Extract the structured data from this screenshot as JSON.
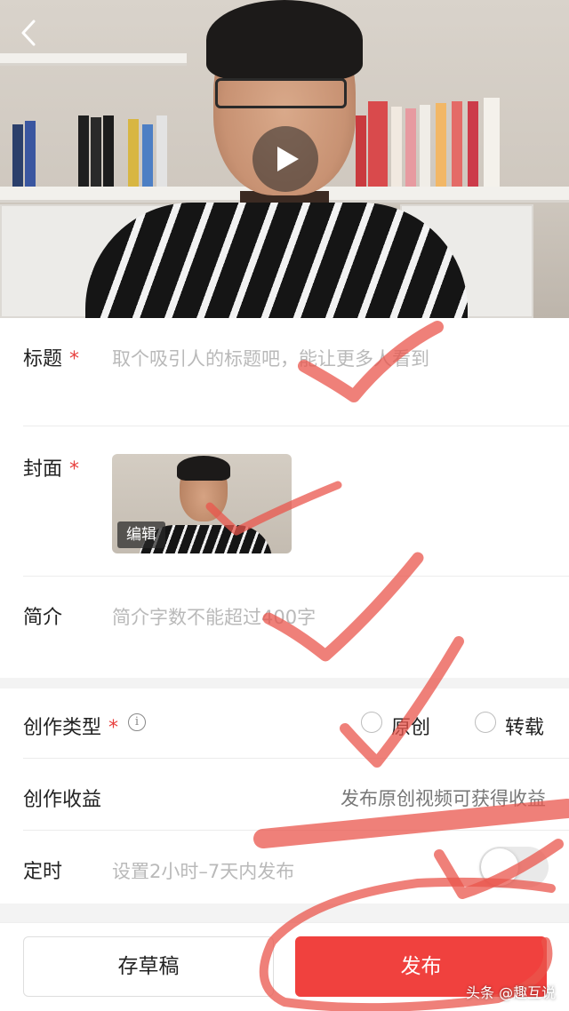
{
  "nav": {
    "back_icon": "chevron-left-icon"
  },
  "video": {
    "play_icon": "play-icon"
  },
  "form": {
    "title": {
      "label": "标题",
      "required_mark": "*",
      "placeholder": "取个吸引人的标题吧，能让更多人看到"
    },
    "cover": {
      "label": "封面",
      "required_mark": "*",
      "edit_label": "编辑"
    },
    "intro": {
      "label": "简介",
      "placeholder": "简介字数不能超过400字"
    },
    "creation_type": {
      "label": "创作类型",
      "required_mark": "*",
      "info_icon": "i",
      "options": [
        {
          "label": "原创",
          "selected": false
        },
        {
          "label": "转载",
          "selected": false
        }
      ]
    },
    "earnings": {
      "label": "创作收益",
      "hint": "发布原创视频可获得收益"
    },
    "schedule": {
      "label": "定时",
      "placeholder": "设置2小时–7天内发布",
      "enabled": false
    }
  },
  "actions": {
    "draft_label": "存草稿",
    "publish_label": "发布"
  },
  "watermark": "头条 @趣互说",
  "colors": {
    "accent": "#f0413e",
    "required": "#e8403e",
    "annotation": "#e9564c"
  }
}
